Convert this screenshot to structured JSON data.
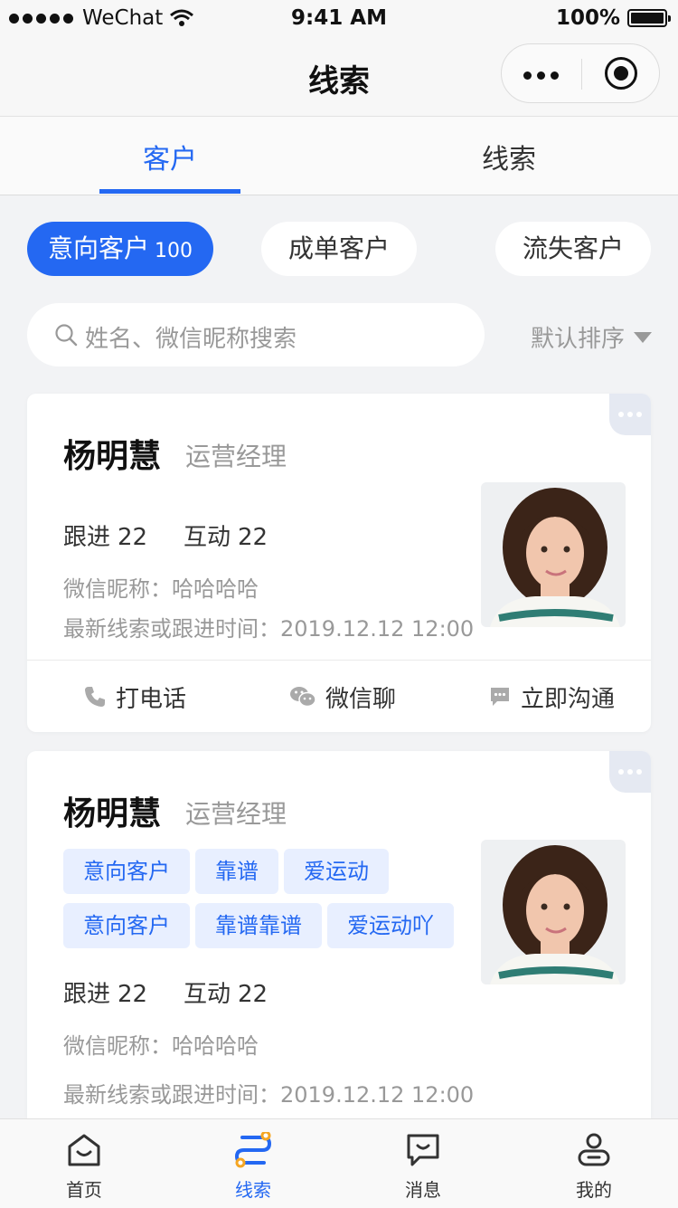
{
  "status_bar": {
    "carrier": "WeChat",
    "time": "9:41 AM",
    "battery": "100%"
  },
  "nav": {
    "title": "线索"
  },
  "tabs": [
    {
      "label": "客户",
      "active": true
    },
    {
      "label": "线索",
      "active": false
    }
  ],
  "filters": [
    {
      "label": "意向客户",
      "count": "100",
      "active": true
    },
    {
      "label": "成单客户",
      "active": false
    },
    {
      "label": "流失客户",
      "active": false
    }
  ],
  "search": {
    "placeholder": "姓名、微信昵称搜索",
    "sort_label": "默认排序"
  },
  "cards": [
    {
      "name": "杨明慧",
      "role": "运营经理",
      "follow_label": "跟进",
      "follow_count": "22",
      "interact_label": "互动",
      "interact_count": "22",
      "wechat_line": "微信昵称：哈哈哈哈",
      "latest_line": "最新线索或跟进时间：2019.12.12 12:00",
      "actions": {
        "call": "打电话",
        "wechat": "微信聊",
        "chat": "立即沟通"
      }
    },
    {
      "name": "杨明慧",
      "role": "运营经理",
      "tags": [
        "意向客户",
        "靠谱",
        "爱运动",
        "意向客户",
        "靠谱靠谱",
        "爱运动吖"
      ],
      "follow_label": "跟进",
      "follow_count": "22",
      "interact_label": "互动",
      "interact_count": "22",
      "wechat_line": "微信昵称：哈哈哈哈",
      "latest_line": "最新线索或跟进时间：2019.12.12 12:00"
    }
  ],
  "tabbar": [
    {
      "label": "首页",
      "icon": "home-icon",
      "active": false
    },
    {
      "label": "线索",
      "icon": "clue-icon",
      "active": true
    },
    {
      "label": "消息",
      "icon": "message-icon",
      "active": false
    },
    {
      "label": "我的",
      "icon": "profile-icon",
      "active": false
    }
  ],
  "colors": {
    "accent": "#2468f2",
    "orange": "#f5a623"
  }
}
